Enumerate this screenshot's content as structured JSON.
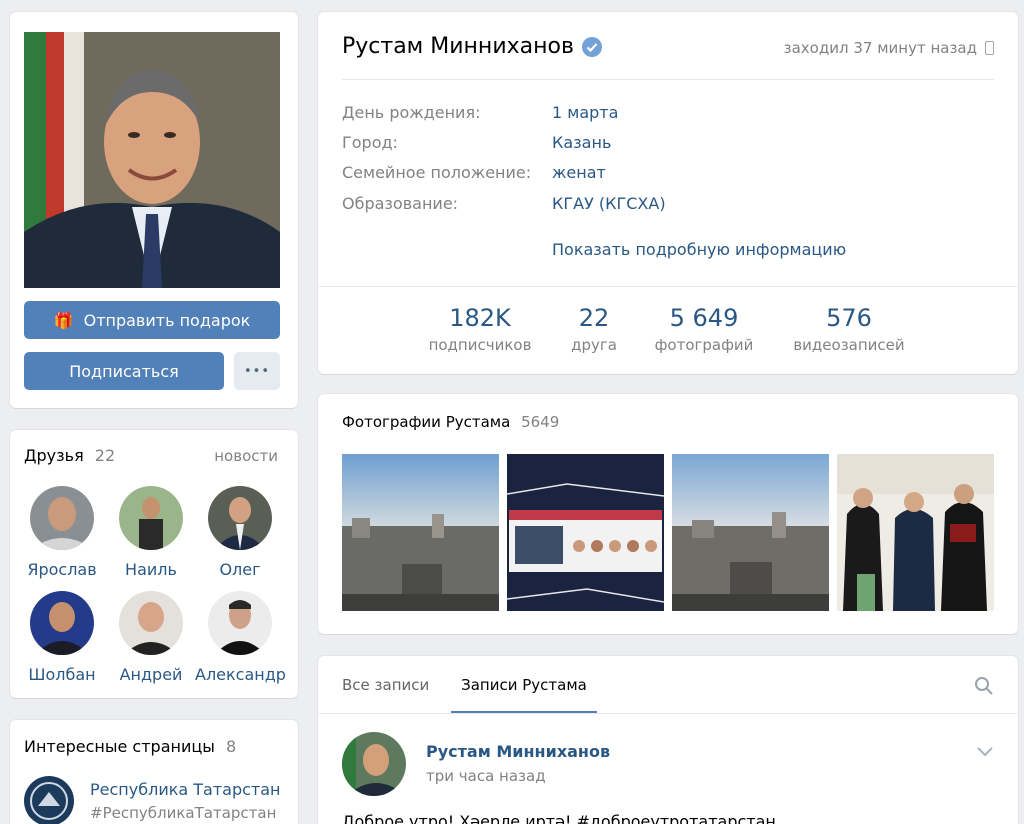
{
  "profile": {
    "name": "Рустам Минниханов",
    "last_seen": "заходил 37 минут назад",
    "info": [
      {
        "label": "День рождения:",
        "value": "1 марта"
      },
      {
        "label": "Город:",
        "value": "Казань"
      },
      {
        "label": "Семейное положение:",
        "value": "женат"
      },
      {
        "label": "Образование:",
        "value": "КГАУ (КГСХА)"
      }
    ],
    "show_more": "Показать подробную информацию",
    "stats": [
      {
        "num": "182K",
        "label": "подписчиков"
      },
      {
        "num": "22",
        "label": "друга"
      },
      {
        "num": "5 649",
        "label": "фотографий"
      },
      {
        "num": "576",
        "label": "видеозаписей"
      }
    ]
  },
  "actions": {
    "gift": "Отправить подарок",
    "subscribe": "Подписаться",
    "more": "•••"
  },
  "friends": {
    "title": "Друзья",
    "count": "22",
    "news_link": "новости",
    "items": [
      {
        "name": "Ярослав"
      },
      {
        "name": "Наиль"
      },
      {
        "name": "Олег"
      },
      {
        "name": "Шолбан"
      },
      {
        "name": "Андрей"
      },
      {
        "name": "Александр"
      }
    ]
  },
  "pages": {
    "title": "Интересные страницы",
    "count": "8",
    "items": [
      {
        "name": "Республика Татарстан",
        "tag": "#РеспубликаТатарстан"
      }
    ]
  },
  "photos": {
    "title": "Фотографии Рустама",
    "count": "5649"
  },
  "wall": {
    "tabs": [
      "Все записи",
      "Записи Рустама"
    ],
    "active_tab": "Записи Рустама",
    "post": {
      "author": "Рустам Минниханов",
      "time": "три часа назад",
      "text": "Доброе утро! Хәерле иртә! #доброеутротатарстан"
    }
  },
  "colors": {
    "accent": "#5181b8",
    "link": "#2a5885",
    "background": "#edeef0"
  }
}
